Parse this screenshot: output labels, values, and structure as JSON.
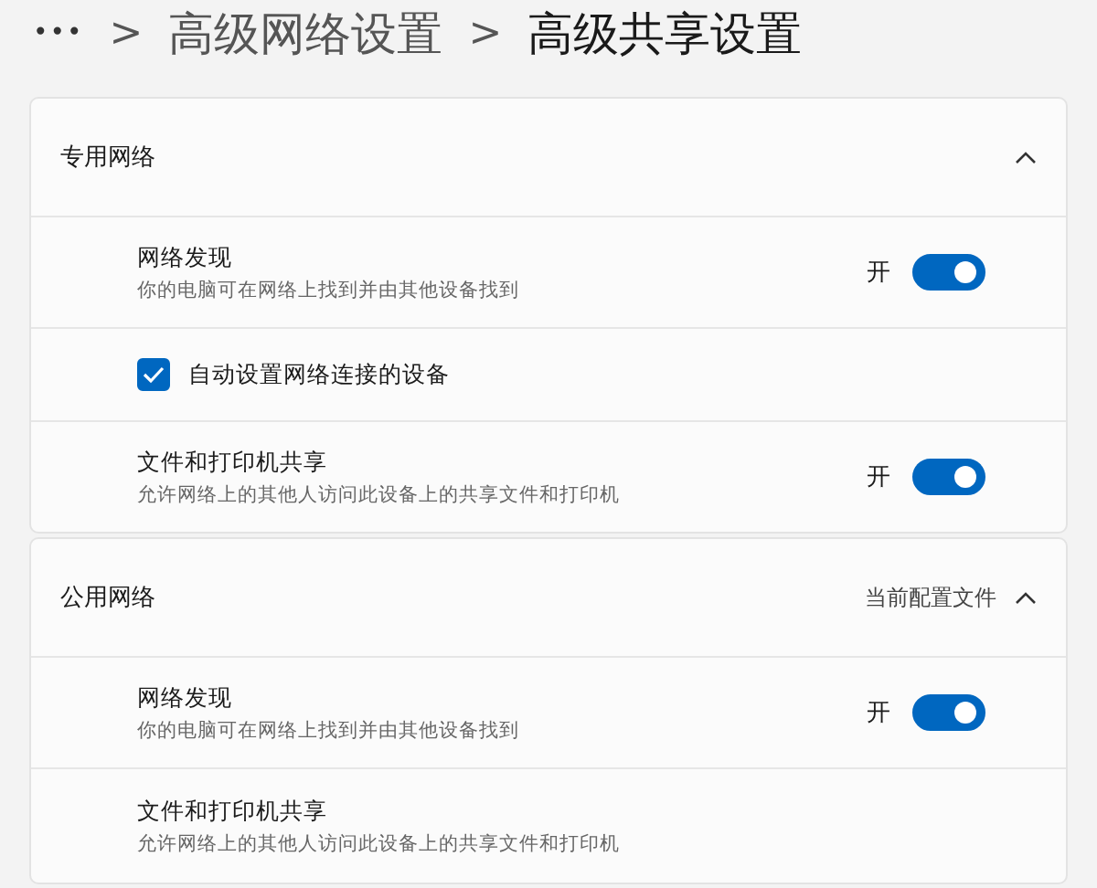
{
  "breadcrumb": {
    "more": "•••",
    "separator": ">",
    "items": [
      "高级网络设置",
      "高级共享设置"
    ]
  },
  "sections": [
    {
      "title": "专用网络",
      "expanded": true,
      "rows": [
        {
          "kind": "toggle",
          "title": "网络发现",
          "subtitle": "你的电脑可在网络上找到并由其他设备找到",
          "state_label": "开",
          "on": true
        },
        {
          "kind": "checkbox",
          "title": "自动设置网络连接的设备",
          "checked": true
        },
        {
          "kind": "toggle",
          "title": "文件和打印机共享",
          "subtitle": "允许网络上的其他人访问此设备上的共享文件和打印机",
          "state_label": "开",
          "on": true
        }
      ]
    },
    {
      "title": "公用网络",
      "badge": "当前配置文件",
      "expanded": true,
      "rows": [
        {
          "kind": "toggle",
          "title": "网络发现",
          "subtitle": "你的电脑可在网络上找到并由其他设备找到",
          "state_label": "开",
          "on": true
        },
        {
          "kind": "text",
          "title": "文件和打印机共享",
          "subtitle": "允许网络上的其他人访问此设备上的共享文件和打印机"
        }
      ]
    }
  ]
}
